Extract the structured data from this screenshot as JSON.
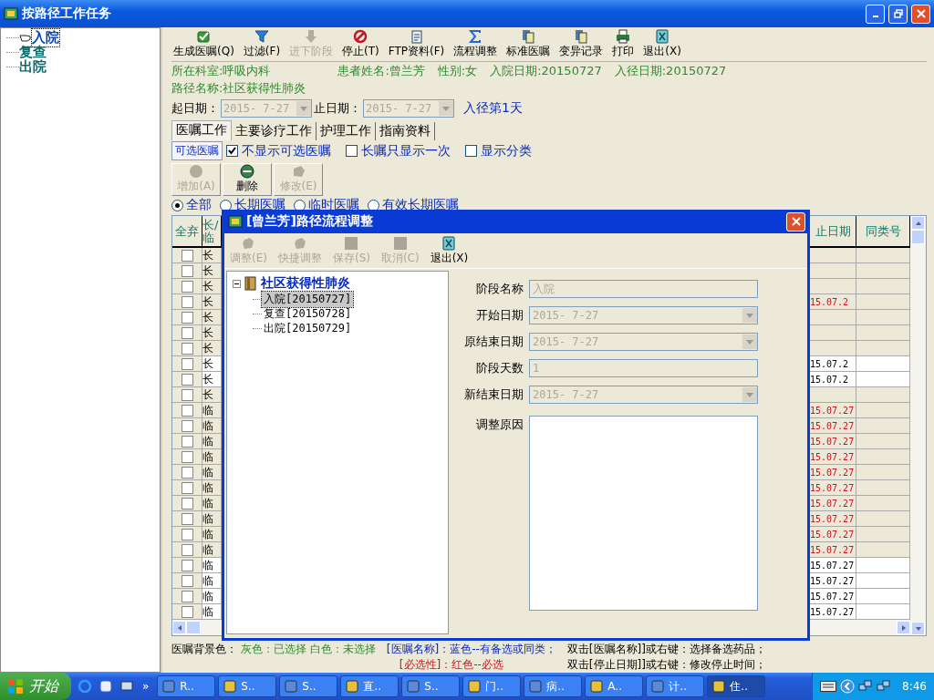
{
  "window": {
    "title": "按路径工作任务"
  },
  "stage_tree": [
    {
      "label": "入院",
      "selected": true
    },
    {
      "label": "复查",
      "selected": false
    },
    {
      "label": "出院",
      "selected": false
    }
  ],
  "toolbar": [
    {
      "label": "生成医嘱(Q)",
      "kind": "check",
      "disabled": false
    },
    {
      "label": "过滤(F)",
      "kind": "filter",
      "disabled": false
    },
    {
      "label": "进下阶段",
      "kind": "down",
      "disabled": true
    },
    {
      "label": "停止(T)",
      "kind": "stop",
      "disabled": false
    },
    {
      "label": "FTP资料(F)",
      "kind": "doc",
      "disabled": false
    },
    {
      "label": "流程调整",
      "kind": "sigma",
      "disabled": false
    },
    {
      "label": "标准医嘱",
      "kind": "pages",
      "disabled": false
    },
    {
      "label": "变异记录",
      "kind": "pages",
      "disabled": false
    },
    {
      "label": "打印",
      "kind": "printer",
      "disabled": false
    },
    {
      "label": "退出(X)",
      "kind": "exit",
      "disabled": false
    }
  ],
  "info": {
    "department": "所在科室:呼吸内科",
    "patient": "患者姓名:曾兰芳",
    "sex": "性别:女",
    "admit_date": "入院日期:20150727",
    "path_date": "入径日期:20150727",
    "path_name": "路径名称:社区获得性肺炎"
  },
  "date_range": {
    "start_label": "起日期：",
    "start": "2015- 7-27",
    "end_label": "止日期：",
    "end": "2015- 7-27",
    "day": "入径第1天"
  },
  "tabs": [
    {
      "label": "医嘱工作",
      "selected": true
    },
    {
      "label": "主要诊疗工作",
      "selected": false
    },
    {
      "label": "护理工作",
      "selected": false
    },
    {
      "label": "指南资料",
      "selected": false
    }
  ],
  "optional_button": "可选医嘱",
  "options": [
    {
      "label": "不显示可选医嘱",
      "checked": true
    },
    {
      "label": "长嘱只显示一次",
      "checked": false
    },
    {
      "label": "显示分类",
      "checked": false
    }
  ],
  "actions": [
    {
      "label": "增加(A)",
      "kind": "add",
      "disabled": true
    },
    {
      "label": "删除",
      "kind": "delete",
      "disabled": false
    },
    {
      "label": "修改(E)",
      "kind": "edit",
      "disabled": true
    }
  ],
  "filters": [
    {
      "label": "全部",
      "selected": true
    },
    {
      "label": "长期医嘱",
      "selected": false
    },
    {
      "label": "临时医嘱",
      "selected": false
    },
    {
      "label": "有效长期医嘱",
      "selected": false
    }
  ],
  "table": {
    "columns": [
      "全弃",
      "长/临",
      "止日期",
      "同类号"
    ],
    "rows": [
      {
        "type": "长",
        "checked": false,
        "chosen": true,
        "required": false
      },
      {
        "type": "长",
        "checked": false,
        "chosen": true,
        "required": false
      },
      {
        "type": "长",
        "checked": false,
        "chosen": true,
        "required": false
      },
      {
        "type": "长",
        "checked": false,
        "chosen": true,
        "required": true,
        "stop_date": "15.07.2"
      },
      {
        "type": "长",
        "checked": false,
        "chosen": true,
        "required": false
      },
      {
        "type": "长",
        "checked": false,
        "chosen": true,
        "required": false
      },
      {
        "type": "长",
        "checked": false,
        "chosen": true,
        "required": false
      },
      {
        "type": "长",
        "checked": false,
        "chosen": false,
        "required": false,
        "stop_date": "15.07.2"
      },
      {
        "type": "长",
        "checked": false,
        "chosen": false,
        "required": false,
        "stop_date": "15.07.2"
      },
      {
        "type": "长",
        "checked": false,
        "chosen": true,
        "required": false
      },
      {
        "type": "临",
        "checked": false,
        "chosen": true,
        "required": true,
        "stop_date": "15.07.27"
      },
      {
        "type": "临",
        "checked": false,
        "chosen": true,
        "required": true,
        "stop_date": "15.07.27"
      },
      {
        "type": "临",
        "checked": false,
        "chosen": true,
        "required": true,
        "stop_date": "15.07.27"
      },
      {
        "type": "临",
        "checked": false,
        "chosen": true,
        "required": true,
        "stop_date": "15.07.27"
      },
      {
        "type": "临",
        "checked": false,
        "chosen": true,
        "required": true,
        "stop_date": "15.07.27"
      },
      {
        "type": "临",
        "checked": false,
        "chosen": true,
        "required": true,
        "stop_date": "15.07.27"
      },
      {
        "type": "临",
        "checked": false,
        "chosen": true,
        "required": true,
        "stop_date": "15.07.27"
      },
      {
        "type": "临",
        "checked": false,
        "chosen": true,
        "required": true,
        "stop_date": "15.07.27"
      },
      {
        "type": "临",
        "checked": false,
        "chosen": true,
        "required": true,
        "stop_date": "15.07.27"
      },
      {
        "type": "临",
        "checked": false,
        "chosen": true,
        "required": true,
        "stop_date": "15.07.27"
      },
      {
        "type": "临",
        "checked": false,
        "chosen": false,
        "required": false,
        "stop_date": "15.07.27"
      },
      {
        "type": "临",
        "checked": false,
        "chosen": false,
        "required": false,
        "stop_date": "15.07.27"
      },
      {
        "type": "临",
        "checked": false,
        "chosen": false,
        "required": false,
        "stop_date": "15.07.27"
      },
      {
        "type": "临",
        "checked": false,
        "chosen": false,
        "required": false,
        "stop_date": "15.07.27"
      }
    ]
  },
  "legend": {
    "label": "医嘱背景色：",
    "colors": "灰色：已选择 白色：未选择",
    "name_note": "[医嘱名称]：蓝色--有备选或同类；",
    "required_note": "[必选性]：红色--必选",
    "hint_1": "双击[医嘱名称]]或右键：选择备选药品；",
    "hint_2": "双击[停止日期]]或右键：修改停止时间；"
  },
  "dialog": {
    "title": "[曾兰芳]路径流程调整",
    "toolbar": [
      {
        "label": "调整(E)",
        "kind": "blob",
        "disabled": true
      },
      {
        "label": "快捷调整",
        "kind": "blob",
        "disabled": true
      },
      {
        "label": "保存(S)",
        "kind": "square",
        "disabled": true
      },
      {
        "label": "取消(C)",
        "kind": "square",
        "disabled": true
      },
      {
        "label": "退出(X)",
        "kind": "exit",
        "disabled": false
      }
    ],
    "tree": {
      "label": "社区获得性肺炎",
      "expanded": true,
      "children": [
        {
          "label": "入院[20150727]",
          "selected": true
        },
        {
          "label": "复查[20150728]",
          "selected": false
        },
        {
          "label": "出院[20150729]",
          "selected": false
        }
      ]
    },
    "form": [
      {
        "label": "阶段名称",
        "kind": "text",
        "value": "入院",
        "disabled": true
      },
      {
        "label": "开始日期",
        "kind": "date",
        "value": "2015- 7-27",
        "disabled": true
      },
      {
        "label": "原结束日期",
        "kind": "date",
        "value": "2015- 7-27",
        "disabled": true
      },
      {
        "label": "阶段天数",
        "kind": "text",
        "value": "1",
        "disabled": true
      },
      {
        "label": "新结束日期",
        "kind": "date",
        "value": "2015- 7-27",
        "disabled": true
      },
      {
        "label": "调整原因",
        "kind": "textarea",
        "disabled": false
      }
    ]
  },
  "taskbar": {
    "start": "开始",
    "more": "»",
    "tasks": [
      {
        "label": "R..",
        "selected": false
      },
      {
        "label": "S..",
        "selected": false
      },
      {
        "label": "S..",
        "selected": false
      },
      {
        "label": "直..",
        "selected": false
      },
      {
        "label": "S..",
        "selected": false
      },
      {
        "label": "门..",
        "selected": false
      },
      {
        "label": "病..",
        "selected": false
      },
      {
        "label": "A..",
        "selected": false
      },
      {
        "label": "计..",
        "selected": false
      },
      {
        "label": "住..",
        "selected": true
      }
    ],
    "clock": "8:46"
  }
}
